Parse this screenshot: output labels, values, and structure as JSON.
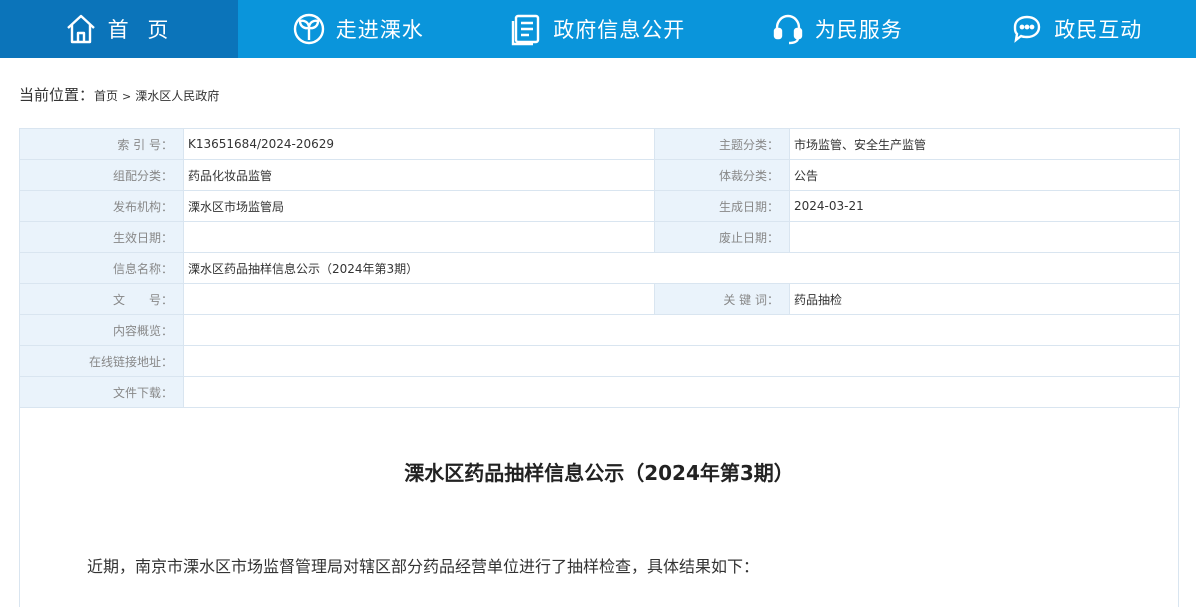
{
  "nav": [
    {
      "label": "首 页",
      "icon": "home-icon"
    },
    {
      "label": "走进溧水",
      "icon": "sprout-icon"
    },
    {
      "label": "政府信息公开",
      "icon": "document-icon"
    },
    {
      "label": "为民服务",
      "icon": "headset-icon"
    },
    {
      "label": "政民互动",
      "icon": "chat-icon"
    }
  ],
  "breadcrumb": {
    "prefix": "当前位置：",
    "home": "首页",
    "separator": ">",
    "current": "溧水区人民政府"
  },
  "meta": {
    "index_label": "索 引 号：",
    "index_value": "K13651684/2024-20629",
    "topic_label": "主题分类：",
    "topic_value": "市场监管、安全生产监管",
    "group_label": "组配分类：",
    "group_value": "药品化妆品监管",
    "genre_label": "体裁分类：",
    "genre_value": "公告",
    "org_label": "发布机构：",
    "org_value": "溧水区市场监管局",
    "created_label": "生成日期：",
    "created_value": "2024-03-21",
    "effective_label": "生效日期：",
    "effective_value": "",
    "expiry_label": "废止日期：",
    "expiry_value": "",
    "name_label": "信息名称：",
    "name_value": "溧水区药品抽样信息公示（2024年第3期）",
    "docno_label": "文　　号：",
    "docno_value": "",
    "keyword_label": "关 键 词：",
    "keyword_value": "药品抽检",
    "summary_label": "内容概览：",
    "summary_value": "",
    "link_label": "在线链接地址：",
    "link_value": "",
    "download_label": "文件下载：",
    "download_value": ""
  },
  "article": {
    "title": "溧水区药品抽样信息公示（2024年第3期）",
    "intro": "近期，南京市溧水区市场监督管理局对辖区部分药品经营单位进行了抽样检查，具体结果如下："
  },
  "colors": {
    "nav_bg": "#0a95db",
    "nav_active": "#0b74ba",
    "label_bg": "#eaf3fb",
    "border": "#d9e5f0"
  }
}
